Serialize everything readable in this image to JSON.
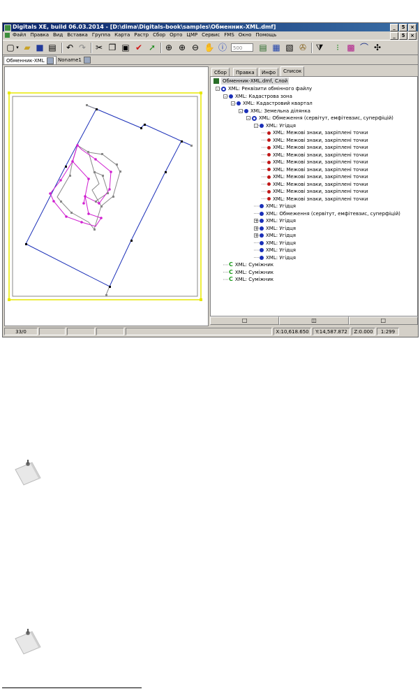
{
  "window": {
    "title": "Digitals XE, build 06.03.2014 - [D:\\dima\\Digitals-book\\samples\\Обменник-XML.dmf]",
    "controls": [
      "_",
      "5",
      "×"
    ]
  },
  "menu": [
    "Файл",
    "Правка",
    "Вид",
    "Вставка",
    "Группа",
    "Карта",
    "Растр",
    "Сбор",
    "Орто",
    "ЦМР",
    "Сервис",
    "FMS",
    "Окно",
    "Помощь"
  ],
  "toolbar": {
    "scale_value": "500",
    "icons": [
      "new-icon",
      "dropdown-icon",
      "open-icon",
      "save-icon",
      "print-icon",
      "undo-icon",
      "redo-icon",
      "cut-icon",
      "copy-icon",
      "paste-icon",
      "check-icon",
      "redo-arrow-icon",
      "add-layer-icon",
      "zoom-in-icon",
      "zoom-out-icon",
      "hand-icon",
      "info-icon",
      "layers-icon",
      "table-icon",
      "properties-icon",
      "tools-icon",
      "filter-icon",
      "traffic-icon",
      "raster-icon",
      "curve-icon",
      "snap-icon"
    ]
  },
  "doc_tabs": [
    {
      "label": "Обменник-XML",
      "active": true
    },
    {
      "label": "Noname1",
      "active": false
    }
  ],
  "panel": {
    "tabs": [
      {
        "label": "Сбор",
        "active": false
      },
      {
        "label": "Правка",
        "active": false
      },
      {
        "label": "Инфо",
        "active": false
      },
      {
        "label": "Список",
        "active": true
      }
    ],
    "tree_root": "Обменник-XML.dmf, Слой",
    "tree": [
      {
        "label": "XML: Реквізити обмінного файлу",
        "level": 1,
        "icon": "ring",
        "exp": "-"
      },
      {
        "label": "XML: Кадастрова зона",
        "level": 2,
        "icon": "blue",
        "exp": "-"
      },
      {
        "label": "XML: Кадастровий квартал",
        "level": 3,
        "icon": "blue",
        "exp": "-"
      },
      {
        "label": "XML: Земельна ділянка",
        "level": 4,
        "icon": "blue",
        "exp": "-"
      },
      {
        "label": "XML: Обмеження (сервітут, емфітевзис, суперфіцій)",
        "level": 5,
        "icon": "ring",
        "exp": "-"
      },
      {
        "label": "XML: Угідця",
        "level": 6,
        "icon": "blue",
        "exp": "-"
      },
      {
        "label": "XML: Межові знаки, закріплені точки",
        "level": 7,
        "icon": "red",
        "exp": ""
      },
      {
        "label": "XML: Межові знаки, закріплені точки",
        "level": 7,
        "icon": "red",
        "exp": ""
      },
      {
        "label": "XML: Межові знаки, закріплені точки",
        "level": 7,
        "icon": "red",
        "exp": ""
      },
      {
        "label": "XML: Межові знаки, закріплені точки",
        "level": 7,
        "icon": "red",
        "exp": ""
      },
      {
        "label": "XML: Межові знаки, закріплені точки",
        "level": 7,
        "icon": "red",
        "exp": ""
      },
      {
        "label": "XML: Межові знаки, закріплені точки",
        "level": 7,
        "icon": "red",
        "exp": ""
      },
      {
        "label": "XML: Межові знаки, закріплені точки",
        "level": 7,
        "icon": "red",
        "exp": ""
      },
      {
        "label": "XML: Межові знаки, закріплені точки",
        "level": 7,
        "icon": "red",
        "exp": ""
      },
      {
        "label": "XML: Межові знаки, закріплені точки",
        "level": 7,
        "icon": "red",
        "exp": ""
      },
      {
        "label": "XML: Межові знаки, закріплені точки",
        "level": 7,
        "icon": "red",
        "exp": ""
      },
      {
        "label": "XML: Угідця",
        "level": 6,
        "icon": "blue",
        "exp": ""
      },
      {
        "label": "XML: Обмеження (сервітут, емфітевзис, суперфіцій)",
        "level": 6,
        "icon": "blue",
        "exp": ""
      },
      {
        "label": "XML: Угідця",
        "level": 6,
        "icon": "blue",
        "exp": "+"
      },
      {
        "label": "XML: Угідця",
        "level": 6,
        "icon": "blue",
        "exp": "+"
      },
      {
        "label": "XML: Угідця",
        "level": 6,
        "icon": "blue",
        "exp": "+"
      },
      {
        "label": "XML: Угідця",
        "level": 6,
        "icon": "blue",
        "exp": ""
      },
      {
        "label": "XML: Угідця",
        "level": 6,
        "icon": "blue",
        "exp": ""
      },
      {
        "label": "XML: Угідця",
        "level": 6,
        "icon": "blue",
        "exp": ""
      },
      {
        "label": "XML: Суміжник",
        "level": 2,
        "icon": "c",
        "exp": ""
      },
      {
        "label": "XML: Суміжник",
        "level": 2,
        "icon": "c",
        "exp": ""
      },
      {
        "label": "XML: Суміжник",
        "level": 2,
        "icon": "c",
        "exp": ""
      }
    ],
    "bottom_buttons": [
      "□",
      "◫",
      "□"
    ]
  },
  "status": {
    "count": "33/0",
    "x": "X:10,618.650",
    "y": "Y:14,587.872",
    "z": "Z:0.000",
    "scale": "1:299"
  },
  "colors": {
    "titlebar": "#0a246a",
    "chrome": "#d4d0c8",
    "blue_line": "#1a2fb8",
    "magenta_line": "#d020d0",
    "frame_yellow": "#f0f000"
  }
}
